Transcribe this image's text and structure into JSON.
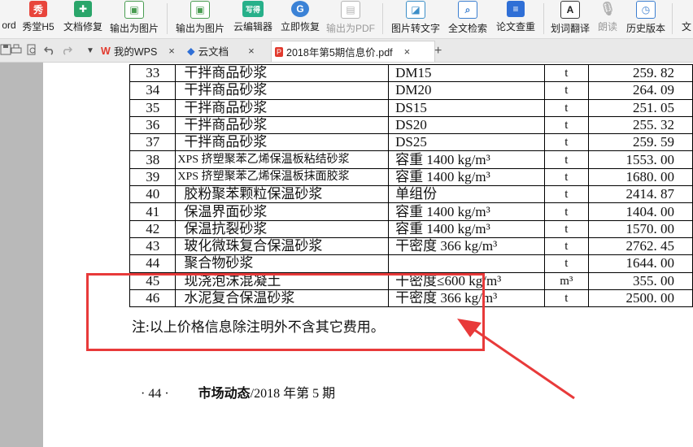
{
  "ribbon": {
    "items": [
      {
        "label": "ord"
      },
      {
        "label": "秀堂H5",
        "icon": "xiu-icon"
      },
      {
        "label": "文档修复",
        "icon": "doc-repair-icon"
      },
      {
        "label": "输出为图片",
        "icon": "export-image-icon"
      },
      {
        "label": "输出为图片",
        "icon": "export-image-icon"
      },
      {
        "label": "云编辑器",
        "icon": "cloud-editor-icon"
      },
      {
        "label": "立即恢复",
        "icon": "restore-icon"
      },
      {
        "label": "输出为PDF",
        "icon": "export-pdf-icon",
        "disabled": true
      },
      {
        "label": "图片转文字",
        "icon": "ocr-icon"
      },
      {
        "label": "全文检索",
        "icon": "fulltext-search-icon"
      },
      {
        "label": "论文查重",
        "icon": "paper-check-icon"
      },
      {
        "label": "划词翻译",
        "icon": "translate-icon"
      },
      {
        "label": "朗读",
        "icon": "read-aloud-icon",
        "disabled": true
      },
      {
        "label": "历史版本",
        "icon": "history-icon"
      },
      {
        "label": "文"
      }
    ],
    "icon_glyphs": {
      "xiu": "秀",
      "yun": "写得",
      "g": "G",
      "a": "A"
    }
  },
  "tabs": [
    {
      "label": "我的WPS",
      "close": "×"
    },
    {
      "label": "云文档",
      "close": "×"
    },
    {
      "label": "2018年第5期信息价.pdf",
      "close": "×"
    }
  ],
  "new_tab": "+",
  "tab_dropdown": "▼",
  "table": {
    "rows": [
      {
        "no": "33",
        "name": "干拌商品砂浆",
        "spec": "DM15",
        "unit": "t",
        "price": "259. 82"
      },
      {
        "no": "34",
        "name": "干拌商品砂浆",
        "spec": "DM20",
        "unit": "t",
        "price": "264. 09"
      },
      {
        "no": "35",
        "name": "干拌商品砂浆",
        "spec": "DS15",
        "unit": "t",
        "price": "251. 05"
      },
      {
        "no": "36",
        "name": "干拌商品砂浆",
        "spec": "DS20",
        "unit": "t",
        "price": "255. 32"
      },
      {
        "no": "37",
        "name": "干拌商品砂浆",
        "spec": "DS25",
        "unit": "t",
        "price": "259. 59"
      },
      {
        "no": "38",
        "name": "XPS 挤塑聚苯乙烯保温板粘结砂浆",
        "spec": "容重 1400 kg/m³",
        "unit": "t",
        "price": "1553. 00",
        "small": true
      },
      {
        "no": "39",
        "name": "XPS 挤塑聚苯乙烯保温板抹面胶浆",
        "spec": "容重 1400 kg/m³",
        "unit": "t",
        "price": "1680. 00",
        "small": true
      },
      {
        "no": "40",
        "name": "胶粉聚苯颗粒保温砂浆",
        "spec": "单组份",
        "unit": "t",
        "price": "2414. 87"
      },
      {
        "no": "41",
        "name": "保温界面砂浆",
        "spec": "容重 1400 kg/m³",
        "unit": "t",
        "price": "1404. 00"
      },
      {
        "no": "42",
        "name": "保温抗裂砂浆",
        "spec": "容重 1400 kg/m³",
        "unit": "t",
        "price": "1570. 00"
      },
      {
        "no": "43",
        "name": "玻化微珠复合保温砂浆",
        "spec": "干密度 366 kg/m³",
        "unit": "t",
        "price": "2762. 45"
      },
      {
        "no": "44",
        "name": "聚合物砂浆",
        "spec": "",
        "unit": "t",
        "price": "1644. 00"
      },
      {
        "no": "45",
        "name": "现浇泡沫混凝土",
        "spec": "干密度≤600 kg/m³",
        "unit": "m³",
        "price": "355. 00"
      },
      {
        "no": "46",
        "name": "水泥复合保温砂浆",
        "spec": "干密度 366 kg/m³",
        "unit": "t",
        "price": "2500. 00"
      }
    ]
  },
  "note": "注:以上价格信息除注明外不含其它费用。",
  "footer": {
    "page": "· 44 ·",
    "title": "市场动态",
    "issue": "/2018 年第 5 期"
  },
  "colors": {
    "annotation": "#e83a3a",
    "ribbon_bg": "#f4f4f4",
    "sidebar_gray": "#b9b9b9"
  }
}
